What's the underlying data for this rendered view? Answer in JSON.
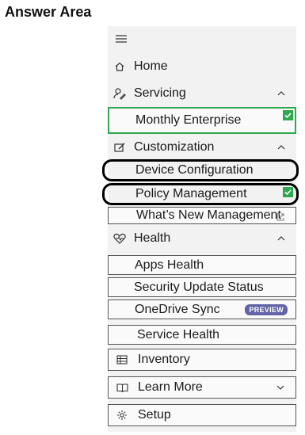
{
  "answer_area": {
    "title": "Answer Area"
  },
  "nav": {
    "menu_icon": "hamburger-icon",
    "home": {
      "label": "Home",
      "icon": "home-icon"
    },
    "servicing": {
      "label": "Servicing",
      "icon": "servicing-icon",
      "expanded": true,
      "items": [
        {
          "label": "Monthly Enterprise",
          "checked": true
        }
      ]
    },
    "customization": {
      "label": "Customization",
      "icon": "customization-icon",
      "expanded": true,
      "items": [
        {
          "label": "Device Configuration",
          "circled": true
        },
        {
          "label": "Policy Management",
          "circled": true,
          "checked": true
        },
        {
          "label": "What’s New Management",
          "external": true
        }
      ]
    },
    "health": {
      "label": "Health",
      "icon": "heart-pulse-icon",
      "expanded": true,
      "items": [
        {
          "label": "Apps Health"
        },
        {
          "label": "Security Update Status"
        },
        {
          "label": "OneDrive Sync",
          "badge": "PREVIEW"
        },
        {
          "label": "Service Health"
        }
      ]
    },
    "inventory": {
      "label": "Inventory",
      "icon": "inventory-icon"
    },
    "learn_more": {
      "label": "Learn More",
      "icon": "book-icon",
      "expanded": false
    },
    "setup": {
      "label": "Setup",
      "icon": "gear-icon"
    }
  },
  "colors": {
    "check": "#2fa84f",
    "badge": "#6264a7",
    "panel": "#f2f2f2",
    "annotation": "#000000"
  }
}
